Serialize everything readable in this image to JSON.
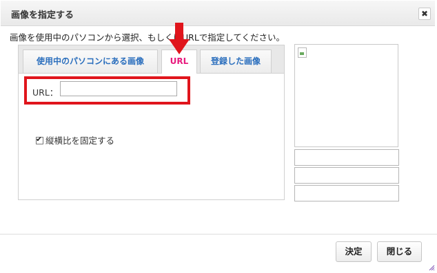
{
  "dialog": {
    "title": "画像を指定する",
    "close_glyph": "✖",
    "instruction": "画像を使用中のパソコンから選択、もしくはURLで指定してください。"
  },
  "tabs": [
    {
      "label": "使用中のパソコンにある画像",
      "active": false
    },
    {
      "label": "URL",
      "active": true
    },
    {
      "label": "登録した画像",
      "active": false
    }
  ],
  "url_field": {
    "label": "URL：",
    "value": "",
    "placeholder": ""
  },
  "aspect": {
    "label": "縦横比を固定する",
    "checked": true,
    "check_glyph": "✔"
  },
  "buttons": {
    "ok": "決定",
    "close": "閉じる"
  },
  "colors": {
    "tab_text": "#2a6ebd",
    "active_tab_text": "#e8197d",
    "annotation_red": "#e0151c"
  },
  "icons": {
    "close": "close-icon",
    "arrow": "arrow-down-icon",
    "preview": "broken-image-icon",
    "resize": "resize-grip-icon"
  }
}
